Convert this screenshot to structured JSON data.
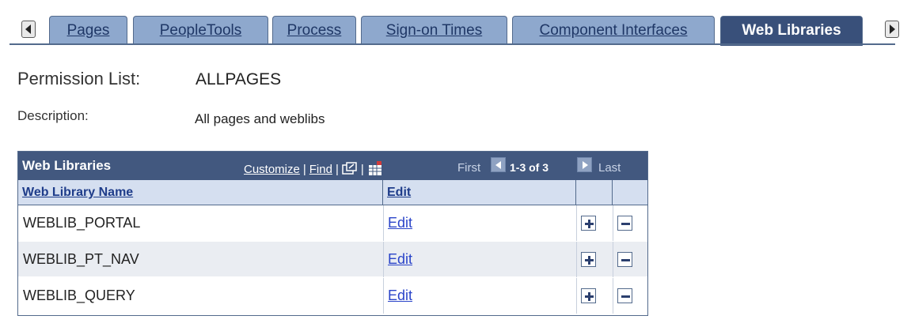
{
  "tabs": {
    "items": [
      {
        "label": "Pages"
      },
      {
        "label": "PeopleTools"
      },
      {
        "label": "Process"
      },
      {
        "label": "Sign-on Times"
      },
      {
        "label": "Component Interfaces"
      },
      {
        "label": "Web Libraries",
        "active": true
      }
    ],
    "prev_icon": "scroll-left-arrow",
    "next_icon": "scroll-right-arrow"
  },
  "permission_list": {
    "label": "Permission List:",
    "value": "ALLPAGES"
  },
  "description": {
    "label": "Description:",
    "value": "All pages and weblibs"
  },
  "grid": {
    "title": "Web Libraries",
    "customize": "Customize",
    "find": "Find",
    "separator": "|",
    "zoom_icon": "view-all-icon",
    "download_icon": "download-spreadsheet-icon",
    "nav": {
      "first": "First",
      "count": "1-3 of 3",
      "last": "Last"
    },
    "columns": [
      {
        "label": "Web Library Name"
      },
      {
        "label": "Edit"
      }
    ],
    "rows": [
      {
        "name": "WEBLIB_PORTAL",
        "edit": "Edit"
      },
      {
        "name": "WEBLIB_PT_NAV",
        "edit": "Edit"
      },
      {
        "name": "WEBLIB_QUERY",
        "edit": "Edit"
      }
    ]
  },
  "colors": {
    "tab_inactive": "#8ea8cd",
    "tab_active": "#39507a",
    "grid_header": "#42587f",
    "column_header": "#d5dff0",
    "link": "#2a44c9"
  }
}
